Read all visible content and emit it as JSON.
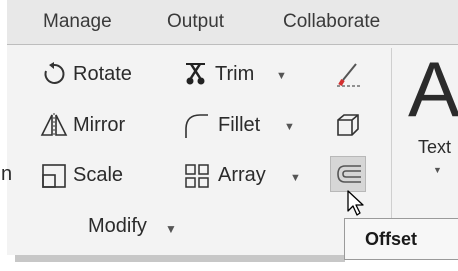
{
  "tabs": [
    {
      "label": "Manage"
    },
    {
      "label": "Output"
    },
    {
      "label": "Collaborate"
    }
  ],
  "modify_panel": {
    "rotate_label": "Rotate",
    "mirror_label": "Mirror",
    "scale_label": "Scale",
    "trim_label": "Trim",
    "fillet_label": "Fillet",
    "array_label": "Array",
    "panel_title": "Modify",
    "edge_letter": "n"
  },
  "annotation_panel": {
    "text_label": "Text",
    "big_letter": "A"
  },
  "tooltip": {
    "label": "Offset"
  },
  "icons": {
    "rotate": "rotate-icon",
    "mirror": "mirror-icon",
    "scale": "scale-icon",
    "trim": "scissors-icon",
    "fillet": "fillet-icon",
    "array": "array-icon",
    "erase": "eraser-icon",
    "explode": "box-3d-icon",
    "offset": "offset-icon",
    "cursor": "mouse-pointer-icon"
  },
  "colors": {
    "ribbon_bg": "#f3f3f3",
    "tab_bar_bg": "#e8e8e8",
    "erase_accent": "#d32f2f",
    "highlight": "#d6d6d6"
  }
}
